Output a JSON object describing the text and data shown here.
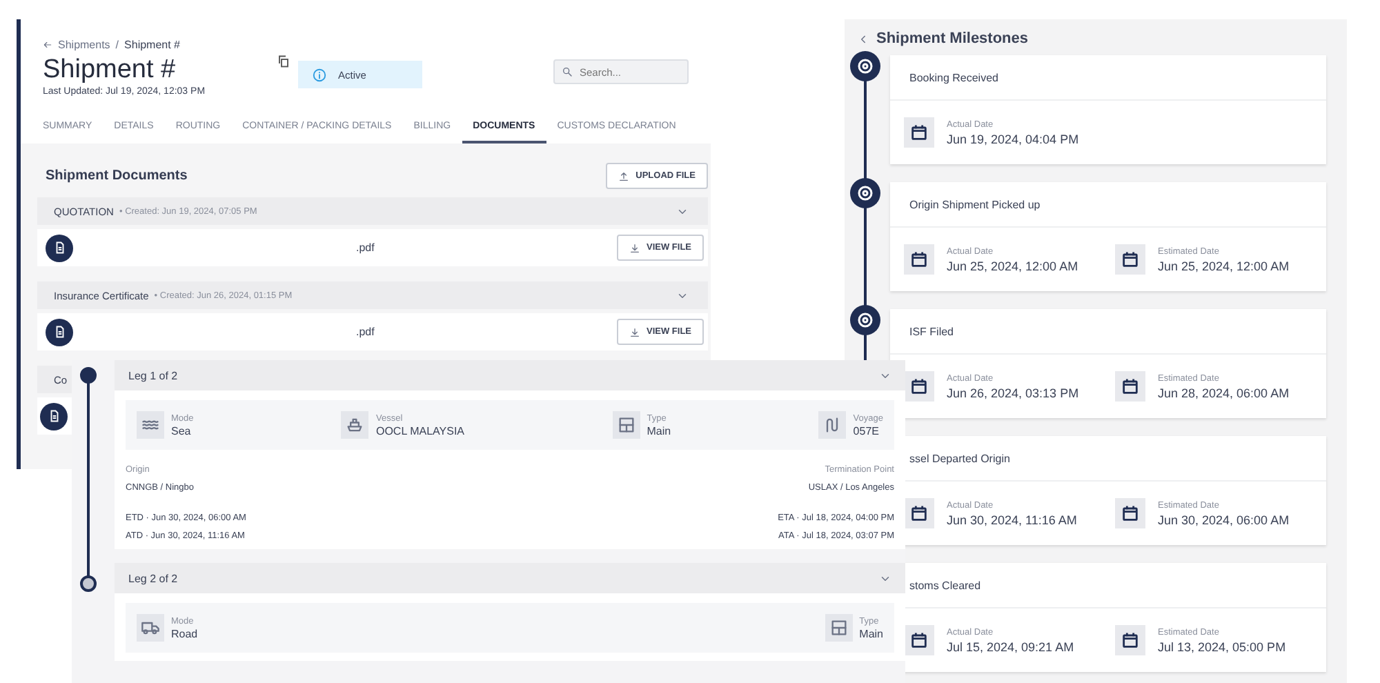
{
  "documents_panel": {
    "breadcrumb": {
      "items": [
        "Shipments",
        "Shipment #"
      ],
      "separator": "/"
    },
    "title": "Shipment #",
    "last_updated": "Last Updated: Jul 19, 2024, 12:03 PM",
    "status": "Active",
    "search": {
      "placeholder": "Search..."
    },
    "tabs": [
      {
        "label": "SUMMARY",
        "selected": false
      },
      {
        "label": "DETAILS",
        "selected": false
      },
      {
        "label": "ROUTING",
        "selected": false
      },
      {
        "label": "CONTAINER / PACKING DETAILS",
        "selected": false
      },
      {
        "label": "BILLING",
        "selected": false
      },
      {
        "label": "DOCUMENTS",
        "selected": true
      },
      {
        "label": "CUSTOMS DECLARATION",
        "selected": false
      }
    ],
    "section_title": "Shipment Documents",
    "upload_button": "UPLOAD FILE",
    "groups": [
      {
        "name": "QUOTATION",
        "created": "• Created: Jun 19, 2024, 07:05 PM",
        "files": [
          {
            "kind": "document",
            "name": ".pdf",
            "button": "VIEW FILE"
          }
        ]
      },
      {
        "name": "Insurance Certificate",
        "created": "• Created: Jun 26, 2024, 01:15 PM",
        "files": [
          {
            "kind": "document",
            "name": ".pdf",
            "button": "VIEW FILE"
          }
        ]
      },
      {
        "name": "Co",
        "files": [
          {
            "kind": "document"
          }
        ]
      }
    ]
  },
  "legs_panel": {
    "legs": [
      {
        "title": "Leg 1 of 2",
        "completed": true,
        "details": [
          {
            "kind": "sea",
            "label": "Mode",
            "value": "Sea"
          },
          {
            "kind": "vessel",
            "label": "Vessel",
            "value": "OOCL MALAYSIA"
          },
          {
            "kind": "type",
            "label": "Type",
            "value": "Main"
          },
          {
            "kind": "voyage",
            "label": "Voyage",
            "value": "057E"
          }
        ],
        "origin_label": "Origin",
        "origin": "CNNGB / Ningbo",
        "termination_label": "Termination Point",
        "termination": "USLAX / Los Angeles",
        "departure": [
          "ETD · Jun 30, 2024, 06:00 AM",
          "ATD · Jun 30, 2024, 11:16 AM"
        ],
        "arrival": [
          "ETA · Jul 18, 2024, 04:00 PM",
          "ATA · Jul 18, 2024, 03:07 PM"
        ]
      },
      {
        "title": "Leg 2 of 2",
        "completed": false,
        "details": [
          {
            "kind": "road",
            "label": "Mode",
            "value": "Road"
          },
          {
            "kind": "type",
            "label": "Type",
            "value": "Main"
          }
        ]
      }
    ]
  },
  "milestones_panel": {
    "title": "Shipment Milestones",
    "milestones": [
      {
        "title": "Booking Received",
        "dates": [
          {
            "label": "Actual Date",
            "value": "Jun 19, 2024, 04:04 PM"
          }
        ]
      },
      {
        "title": "Origin Shipment Picked up",
        "dates": [
          {
            "label": "Actual Date",
            "value": "Jun 25, 2024, 12:00 AM"
          },
          {
            "label": "Estimated Date",
            "value": "Jun 25, 2024, 12:00 AM"
          }
        ]
      },
      {
        "title": "ISF Filed",
        "dates": [
          {
            "label": "Actual Date",
            "value": "Jun 26, 2024, 03:13 PM"
          },
          {
            "label": "Estimated Date",
            "value": "Jun 28, 2024, 06:00 AM"
          }
        ]
      },
      {
        "title": "ssel Departed Origin",
        "dates": [
          {
            "label": "Actual Date",
            "value": "Jun 30, 2024, 11:16 AM"
          },
          {
            "label": "Estimated Date",
            "value": "Jun 30, 2024, 06:00 AM"
          }
        ]
      },
      {
        "title": "stoms Cleared",
        "dates": [
          {
            "label": "Actual Date",
            "value": "Jul 15, 2024, 09:21 AM"
          },
          {
            "label": "Estimated Date",
            "value": "Jul 13, 2024, 05:00 PM"
          }
        ]
      }
    ]
  }
}
